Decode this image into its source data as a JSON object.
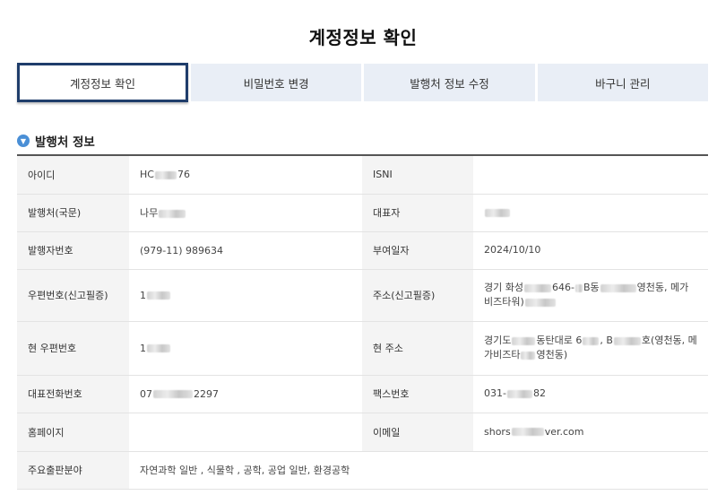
{
  "page_title": "계정정보 확인",
  "tabs": [
    {
      "label": "계정정보 확인",
      "active": true
    },
    {
      "label": "비밀번호 변경",
      "active": false
    },
    {
      "label": "발행처 정보 수정",
      "active": false
    },
    {
      "label": "바구니 관리",
      "active": false
    }
  ],
  "section": {
    "title": "발행처 정보",
    "icon": "chevron-down-icon"
  },
  "rows": {
    "id": {
      "label": "아이디",
      "value_pre": "HC",
      "value_post": "76"
    },
    "isni": {
      "label": "ISNI",
      "value": ""
    },
    "publisher": {
      "label": "발행처(국문)",
      "value_pre": "나무"
    },
    "ceo": {
      "label": "대표자"
    },
    "publisher_no": {
      "label": "발행자번호",
      "value": "(979-11) 989634"
    },
    "granted_date": {
      "label": "부여일자",
      "value": "2024/10/10"
    },
    "zip_reg": {
      "label": "우편번호(신고필증)",
      "value_pre": "1"
    },
    "addr_reg": {
      "label": "주소(신고필증)",
      "line1_pre": "경기 화성",
      "line1_mid": "646-",
      "line1_mid2": "B동",
      "line1_post": "영천동, 메가",
      "line2_pre": "비즈타워)"
    },
    "zip_cur": {
      "label": "현 우편번호",
      "value_pre": "1"
    },
    "addr_cur": {
      "label": "현 주소",
      "line1_pre": "경기도",
      "line1_mid": "동탄대로 6",
      "line1_mid2": ", B",
      "line1_post": "호(영천동, 메",
      "line2_pre": "가비즈타",
      "line2_post": "영천동)"
    },
    "phone": {
      "label": "대표전화번호",
      "value_pre": "07",
      "value_post": "2297"
    },
    "fax": {
      "label": "팩스번호",
      "value_pre": "031-",
      "value_post": "82"
    },
    "homepage": {
      "label": "홈페이지",
      "value": ""
    },
    "email": {
      "label": "이메일",
      "value_pre": "shors",
      "value_post": "ver.com"
    },
    "field": {
      "label": "주요출판분야",
      "value": "자연과학 일반 , 식물학 , 공학, 공업 일반, 환경공학"
    }
  }
}
